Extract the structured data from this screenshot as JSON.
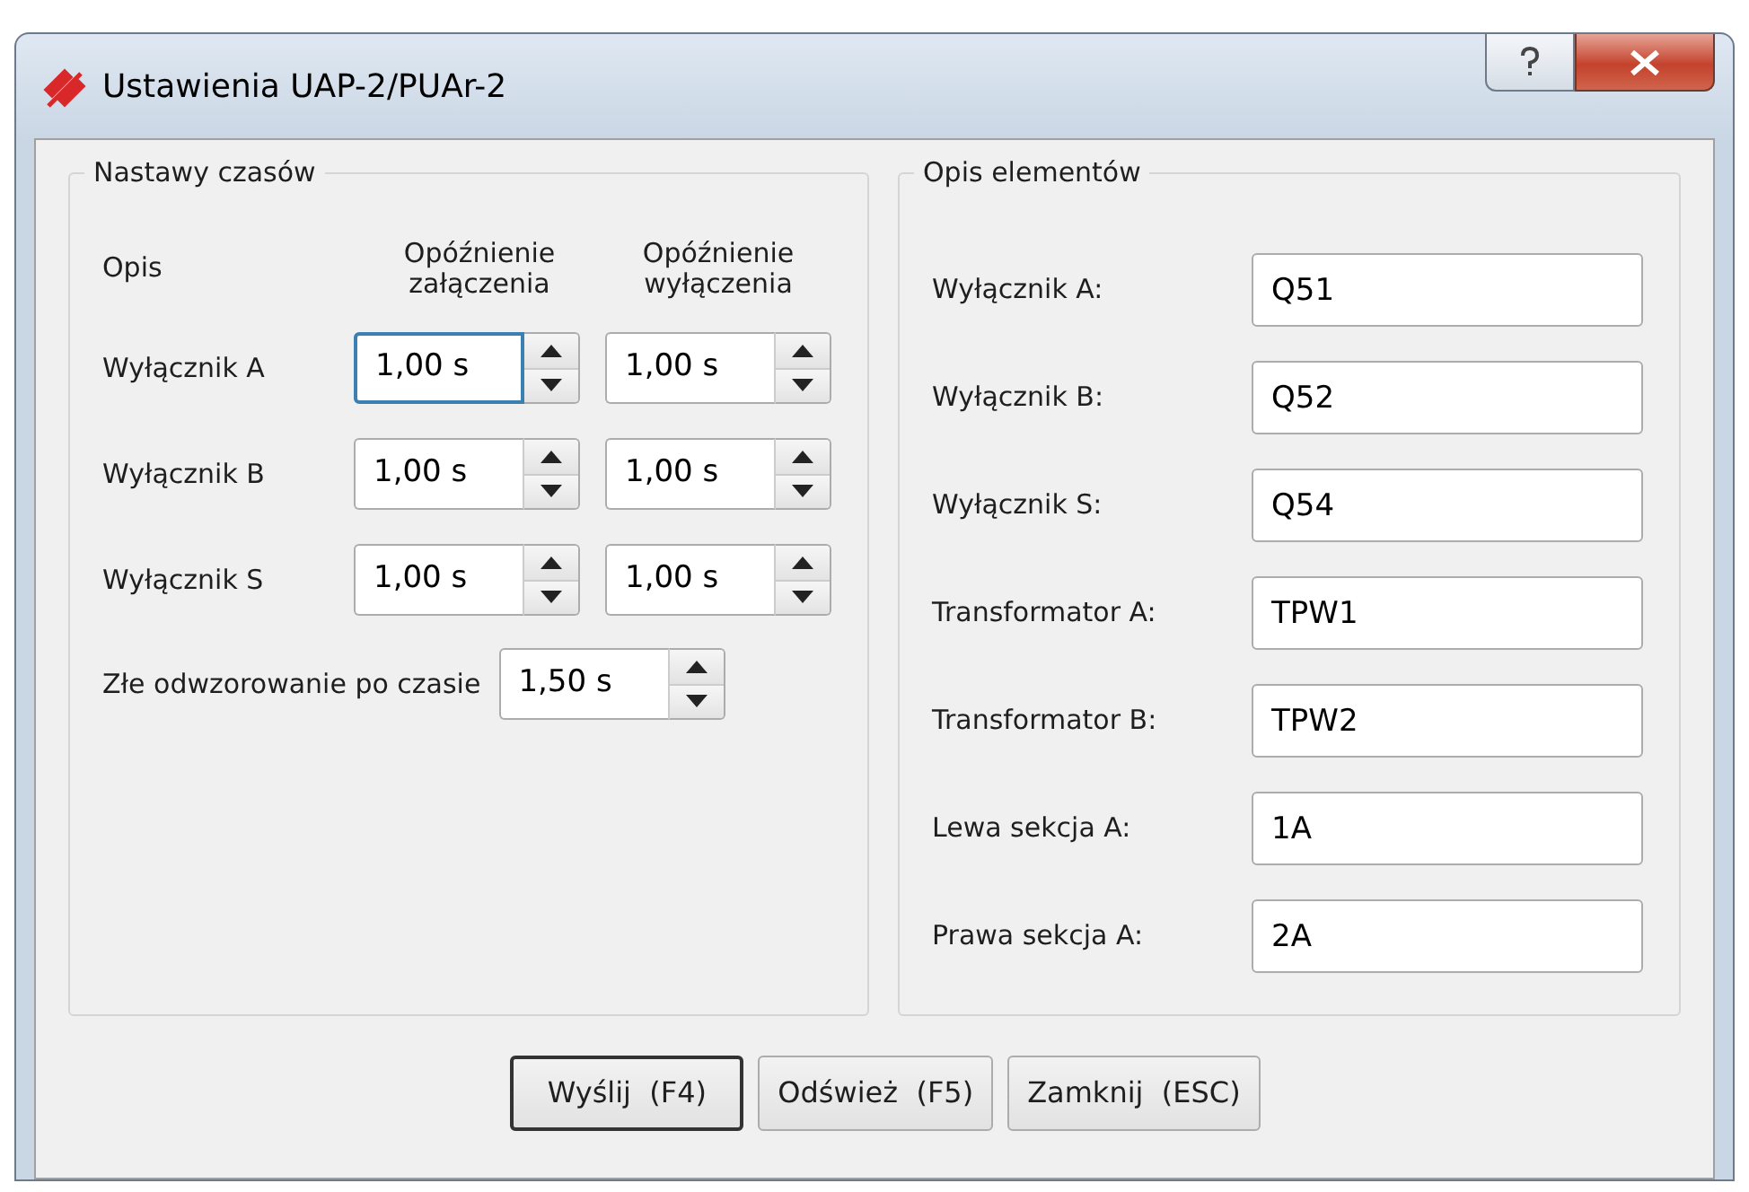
{
  "window": {
    "title": "Ustawienia UAP-2/PUAr-2"
  },
  "timings": {
    "title": "Nastawy czasów",
    "headers": [
      "Opis",
      "Opóźnienie załączenia",
      "Opóźnienie wyłączenia"
    ],
    "rows": [
      {
        "label": "Wyłącznik A",
        "on_delay": {
          "value": "1,00 s",
          "focused": true
        },
        "off_delay": {
          "value": "1,00 s",
          "focused": false
        }
      },
      {
        "label": "Wyłącznik B",
        "on_delay": {
          "value": "1,00 s",
          "focused": false
        },
        "off_delay": {
          "value": "1,00 s",
          "focused": false
        }
      },
      {
        "label": "Wyłącznik S",
        "on_delay": {
          "value": "1,00 s",
          "focused": false
        },
        "off_delay": {
          "value": "1,00 s",
          "focused": false
        }
      }
    ],
    "extra": {
      "label": "Złe odwzorowanie po czasie",
      "value": {
        "value": "1,50 s",
        "focused": false
      }
    }
  },
  "elements": {
    "title": "Opis elementów",
    "fields": [
      {
        "label": "Wyłącznik A:",
        "value": "Q51"
      },
      {
        "label": "Wyłącznik B:",
        "value": "Q52"
      },
      {
        "label": "Wyłącznik S:",
        "value": "Q54"
      },
      {
        "label": "Transformator A:",
        "value": "TPW1"
      },
      {
        "label": "Transformator B:",
        "value": "TPW2"
      },
      {
        "label": "Lewa sekcja A:",
        "value": "1A"
      },
      {
        "label": "Prawa sekcja A:",
        "value": "2A"
      }
    ]
  },
  "buttons": [
    {
      "label": "Wyślij  (F4)",
      "default": true
    },
    {
      "label": "Odśwież  (F5)",
      "default": false
    },
    {
      "label": "Zamknij  (ESC)",
      "default": false
    }
  ]
}
